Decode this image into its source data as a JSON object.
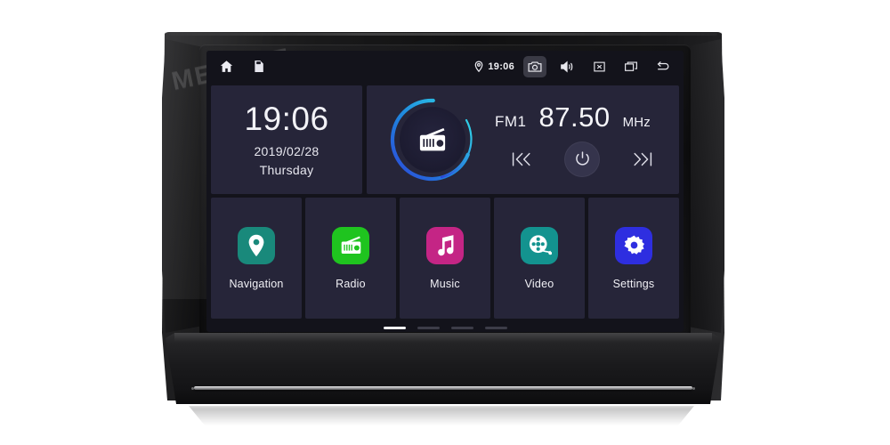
{
  "device": {
    "brand_watermark": "MEKEDE",
    "chassis_color": "#141416"
  },
  "statusbar": {
    "left_icons": [
      {
        "name": "home-icon",
        "label": "Home"
      },
      {
        "name": "sd-card-icon",
        "label": "SD Card"
      }
    ],
    "location_icon": "location-pin-icon",
    "time": "19:06",
    "right_icons": [
      {
        "name": "camera-icon",
        "label": "Camera",
        "active": true
      },
      {
        "name": "volume-icon",
        "label": "Volume",
        "active": false
      },
      {
        "name": "close-box-icon",
        "label": "Close",
        "active": false
      },
      {
        "name": "recents-icon",
        "label": "Recent apps",
        "active": false
      },
      {
        "name": "back-icon",
        "label": "Back",
        "active": false
      }
    ]
  },
  "clock_widget": {
    "time": "19:06",
    "date": "2019/02/28",
    "weekday": "Thursday"
  },
  "radio_widget": {
    "icon": "radio-icon",
    "band": "FM1",
    "frequency": "87.50",
    "unit": "MHz",
    "ring_color_start": "#2fd9e8",
    "ring_color_end": "#2d45d8",
    "controls": [
      {
        "name": "previous-station-button",
        "label": "Previous"
      },
      {
        "name": "power-button",
        "label": "Power"
      },
      {
        "name": "next-station-button",
        "label": "Next"
      }
    ]
  },
  "apps": [
    {
      "label": "Navigation",
      "icon": "map-pin-icon",
      "color": "#19897b"
    },
    {
      "label": "Radio",
      "icon": "radio-icon",
      "color": "#1fc41f"
    },
    {
      "label": "Music",
      "icon": "music-note-icon",
      "color": "#c42585"
    },
    {
      "label": "Video",
      "icon": "film-reel-icon",
      "color": "#13938f"
    },
    {
      "label": "Settings",
      "icon": "gear-icon",
      "color": "#2e2ee0"
    }
  ],
  "pager": {
    "pages": 4,
    "active_index": 0
  }
}
